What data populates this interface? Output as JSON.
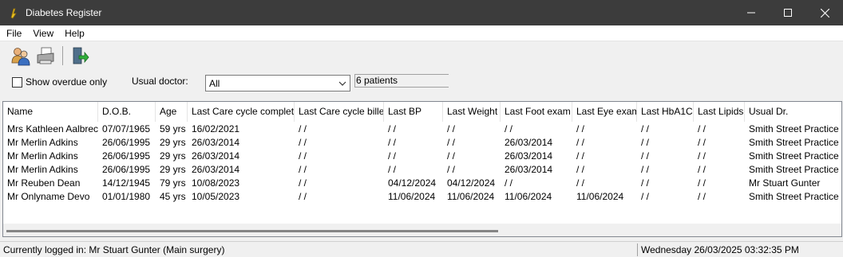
{
  "window": {
    "title": "Diabetes Register"
  },
  "menu": [
    "File",
    "View",
    "Help"
  ],
  "toolbar": {
    "icons": [
      "patients-icon",
      "print-icon",
      "exit-icon"
    ]
  },
  "filter": {
    "overdue_label": "Show overdue only",
    "overdue_checked": false,
    "doctor_label": "Usual doctor:",
    "doctor_value": "All",
    "count_text": "6 patients"
  },
  "table": {
    "columns": [
      "Name",
      "D.O.B.",
      "Age",
      "Last Care cycle complet...",
      "Last Care cycle billed",
      "Last BP",
      "Last Weight",
      "Last Foot exam",
      "Last Eye exam",
      "Last HbA1C",
      "Last Lipids",
      "Usual Dr."
    ],
    "rows": [
      [
        "Mrs Kathleen Aalbrecht",
        "07/07/1965",
        "59 yrs",
        "16/02/2021",
        " / /",
        " / /",
        " / /",
        " / /",
        " / /",
        " / /",
        " / /",
        "Smith Street Practice"
      ],
      [
        "Mr Merlin Adkins",
        "26/06/1995",
        "29 yrs",
        "26/03/2014",
        " / /",
        " / /",
        " / /",
        "26/03/2014",
        " / /",
        " / /",
        " / /",
        "Smith Street Practice"
      ],
      [
        "Mr Merlin Adkins",
        "26/06/1995",
        "29 yrs",
        "26/03/2014",
        " / /",
        " / /",
        " / /",
        "26/03/2014",
        " / /",
        " / /",
        " / /",
        "Smith Street Practice"
      ],
      [
        "Mr Merlin Adkins",
        "26/06/1995",
        "29 yrs",
        "26/03/2014",
        " / /",
        " / /",
        " / /",
        "26/03/2014",
        " / /",
        " / /",
        " / /",
        "Smith Street Practice"
      ],
      [
        "Mr Reuben Dean",
        "14/12/1945",
        "79 yrs",
        "10/08/2023",
        " / /",
        "04/12/2024",
        "04/12/2024",
        " / /",
        " / /",
        " / /",
        " / /",
        "Mr Stuart Gunter"
      ],
      [
        "Mr Onlyname Devo",
        "01/01/1980",
        "45 yrs",
        "10/05/2023",
        " / /",
        "11/06/2024",
        "11/06/2024",
        "11/06/2024",
        "11/06/2024",
        " / /",
        " / /",
        "Smith Street Practice"
      ]
    ]
  },
  "status": {
    "logged_in": "Currently logged in:  Mr Stuart Gunter (Main surgery)",
    "datetime": "Wednesday 26/03/2025 03:32:35 PM"
  }
}
